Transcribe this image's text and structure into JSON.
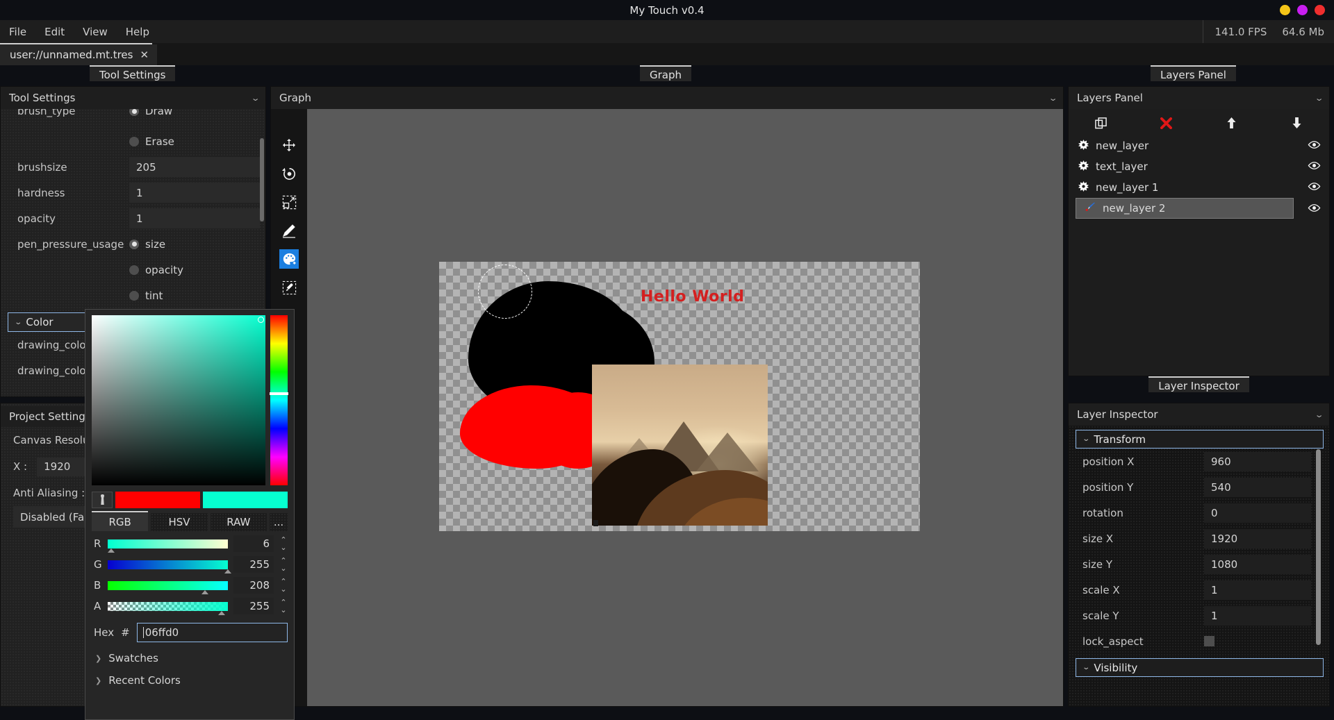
{
  "window": {
    "title": "My Touch v0.4",
    "controls": [
      "minimize",
      "maximize",
      "close"
    ]
  },
  "menubar": {
    "items": [
      "File",
      "Edit",
      "View",
      "Help"
    ],
    "fps": "141.0 FPS",
    "memory": "64.6 Mb"
  },
  "file_tabs": [
    {
      "label": "user://unnamed.mt.tres",
      "close": "✕"
    }
  ],
  "docks": {
    "tool_settings_tab": "Tool Settings",
    "graph_tab": "Graph",
    "layers_tab": "Layers Panel",
    "layer_inspector_tab": "Layer Inspector"
  },
  "tool_settings": {
    "title": "Tool Settings",
    "rows": [
      {
        "label": "brush_type",
        "type": "radio",
        "options": [
          {
            "label": "Draw",
            "selected": true
          },
          {
            "label": "Erase",
            "selected": false
          }
        ]
      },
      {
        "label": "brushsize",
        "type": "value",
        "value": "205"
      },
      {
        "label": "hardness",
        "type": "value",
        "value": "1"
      },
      {
        "label": "opacity",
        "type": "value",
        "value": "1"
      },
      {
        "label": "pen_pressure_usage",
        "type": "radio",
        "options": [
          {
            "label": "size",
            "selected": true
          },
          {
            "label": "opacity",
            "selected": false
          },
          {
            "label": "tint",
            "selected": false
          }
        ]
      }
    ],
    "color_section": "Color",
    "color_rows": [
      "drawing_color",
      "drawing_color"
    ]
  },
  "project_settings": {
    "title": "Project Settings",
    "canvas_resolution_label": "Canvas Resolut",
    "x_label": "X :",
    "x_value": "1920",
    "anti_aliasing_label": "Anti Aliasing :",
    "anti_aliasing_value": "Disabled (Faste"
  },
  "graph": {
    "title": "Graph",
    "tools": [
      {
        "name": "move-tool",
        "selected": false
      },
      {
        "name": "rotate-tool",
        "selected": false
      },
      {
        "name": "resize-tool",
        "selected": false
      },
      {
        "name": "pencil-tool",
        "selected": false
      },
      {
        "name": "palette-tool",
        "selected": true
      },
      {
        "name": "eyedropper-tool",
        "selected": false
      },
      {
        "name": "add-layer-tool",
        "selected": false
      }
    ],
    "canvas_text": "Hello World"
  },
  "layers_panel": {
    "title": "Layers Panel",
    "toolbar": [
      {
        "name": "duplicate-layer-button",
        "glyph": "⧉"
      },
      {
        "name": "delete-layer-button",
        "glyph": "✖"
      },
      {
        "name": "move-layer-up-button",
        "glyph": "↑"
      },
      {
        "name": "move-layer-down-button",
        "glyph": "↓"
      }
    ],
    "layers": [
      {
        "name": "new_layer",
        "icon": "gear-icon",
        "selected": false,
        "visible": true
      },
      {
        "name": "text_layer",
        "icon": "gear-icon",
        "selected": false,
        "visible": true
      },
      {
        "name": "new_layer 1",
        "icon": "gear-icon",
        "selected": false,
        "visible": true
      },
      {
        "name": "new_layer 2",
        "icon": "brush-icon",
        "selected": true,
        "visible": true
      }
    ]
  },
  "layer_inspector": {
    "title": "Layer Inspector",
    "sections": [
      {
        "label": "Transform",
        "expanded": true
      },
      {
        "label": "Visibility",
        "expanded": true
      }
    ],
    "properties": [
      {
        "label": "position X",
        "value": "960"
      },
      {
        "label": "position Y",
        "value": "540"
      },
      {
        "label": "rotation",
        "value": "0"
      },
      {
        "label": "size X",
        "value": "1920"
      },
      {
        "label": "size Y",
        "value": "1080"
      },
      {
        "label": "scale X",
        "value": "1"
      },
      {
        "label": "scale Y",
        "value": "1"
      },
      {
        "label": "lock_aspect",
        "value": "",
        "type": "checkbox"
      }
    ]
  },
  "color_picker": {
    "old_color": "#ff0000",
    "new_color": "#06ffd0",
    "modes": [
      {
        "label": "RGB",
        "active": true
      },
      {
        "label": "HSV",
        "active": false
      },
      {
        "label": "RAW",
        "active": false
      },
      {
        "label": "...",
        "active": false
      }
    ],
    "channels": [
      {
        "label": "R",
        "value": "6",
        "pos": 2
      },
      {
        "label": "G",
        "value": "255",
        "pos": 100
      },
      {
        "label": "B",
        "value": "208",
        "pos": 81
      },
      {
        "label": "A",
        "value": "255",
        "pos": 95
      }
    ],
    "hex_label": "Hex",
    "hex_hash": "#",
    "hex_value": "06ffd0",
    "expanders": [
      "Swatches",
      "Recent Colors"
    ],
    "spin_glyph": "⌃⌄"
  }
}
